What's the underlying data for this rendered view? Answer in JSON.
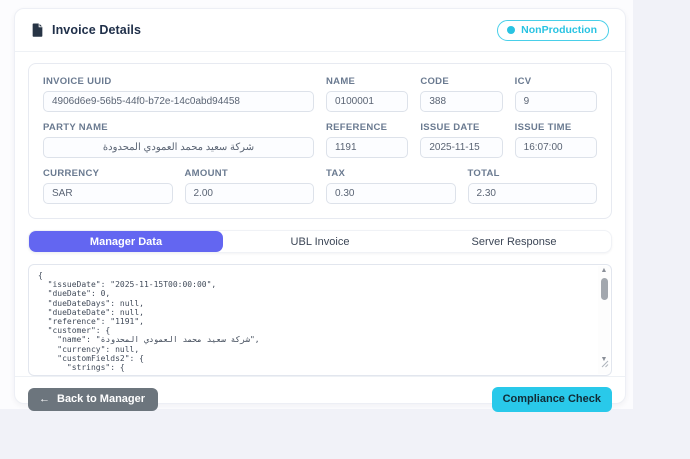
{
  "header": {
    "title": "Invoice Details",
    "badge": {
      "label": "NonProduction"
    }
  },
  "form": {
    "fields": [
      {
        "label": "INVOICE UUID",
        "value": "4906d6e9-56b5-44f0-b72e-14c0abd94458",
        "span": 6
      },
      {
        "label": "NAME",
        "value": "0100001",
        "span": 2
      },
      {
        "label": "CODE",
        "value": "388",
        "span": 2
      },
      {
        "label": "ICV",
        "value": "9",
        "span": 2
      },
      {
        "label": "PARTY NAME",
        "value": "شركة سعيد محمد العمودي المحدودة",
        "span": 6,
        "rtl": true
      },
      {
        "label": "REFERENCE",
        "value": "1191",
        "span": 2
      },
      {
        "label": "ISSUE DATE",
        "value": "2025-11-15",
        "span": 2
      },
      {
        "label": "ISSUE TIME",
        "value": "16:07:00",
        "span": 2
      },
      {
        "label": "CURRENCY",
        "value": "SAR",
        "span": 3
      },
      {
        "label": "AMOUNT",
        "value": "2.00",
        "span": 3
      },
      {
        "label": "TAX",
        "value": "0.30",
        "span": 3
      },
      {
        "label": "TOTAL",
        "value": "2.30",
        "span": 3
      }
    ]
  },
  "tabs": [
    {
      "label": "Manager Data",
      "active": true
    },
    {
      "label": "UBL Invoice",
      "active": false
    },
    {
      "label": "Server Response",
      "active": false
    }
  ],
  "code_view": {
    "content": "{\n  \"issueDate\": \"2025-11-15T00:00:00\",\n  \"dueDate\": 0,\n  \"dueDateDays\": null,\n  \"dueDateDate\": null,\n  \"reference\": \"1191\",\n  \"customer\": {\n    \"name\": \"شركة سعيد محمد العمودي المحدودة\",\n    \"currency\": null,\n    \"customFields2\": {\n      \"strings\": {"
  },
  "footer": {
    "back_arrow": "←",
    "back_label": "Back to Manager",
    "compliance_label": "Compliance Check"
  },
  "icons": {
    "scroll_up": "▲",
    "scroll_down": "▼"
  },
  "colors": {
    "accent_purple": "#6366f1",
    "badge_cyan": "#29c3e2",
    "compliance_cyan": "#29c9ea",
    "back_gray": "#6c757d"
  }
}
